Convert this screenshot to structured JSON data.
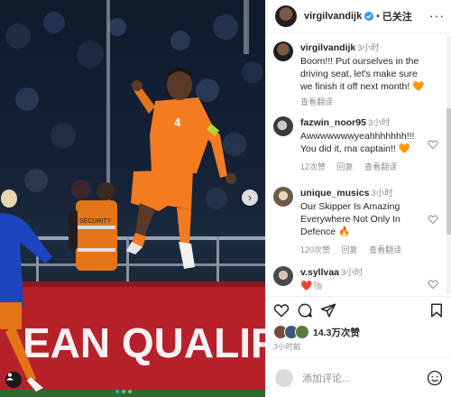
{
  "post": {
    "username": "virgilvandijk",
    "follow_status": "已关注",
    "separator": "•",
    "more": "···"
  },
  "photo": {
    "alt_text": "Dutch captain celebrating in orange kit",
    "jersey_number": "4",
    "banner_text": "EAN QUALIF",
    "vest_text": "SECURITY"
  },
  "comments": [
    {
      "user": "virgilvandijk",
      "time": "3小时",
      "text": "Boom!!! Put ourselves in the driving seat, let's make sure we finish it off next month! 🧡",
      "translate": "查看翻译"
    },
    {
      "user": "fazwin_noor95",
      "time": "3小时",
      "text": "Awwwwwwwyeahhhhhhh!!! You did it, ma captain!! 🧡",
      "likes": "12次赞",
      "reply": "回复",
      "translate": "查看翻译"
    },
    {
      "user": "unique_musics",
      "time": "3小时",
      "text": "Our Skipper Is Amazing Everywhere Not Only In Defence 🔥",
      "likes": "120次赞",
      "reply": "回复",
      "translate": "查看翻译"
    },
    {
      "user": "v.syllvaa",
      "time": "3小时",
      "text": "❤️🐚"
    }
  ],
  "footer": {
    "likes_count": "14.3万次赞",
    "post_time": "3小时前",
    "comment_placeholder": "添加评论..."
  },
  "colors": {
    "orange": "#f47b20",
    "verified_blue": "#3897f0",
    "muted": "#8e8e8e"
  }
}
